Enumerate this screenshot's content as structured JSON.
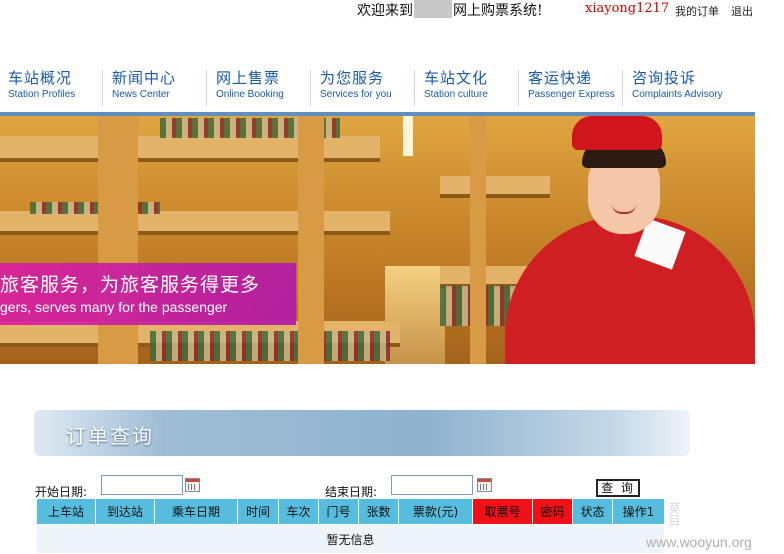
{
  "header": {
    "welcome_before": "欢迎来到",
    "welcome_after": "网上购票系统!",
    "username": "xiayong1217",
    "my_orders": "我的订单",
    "logout": "退出"
  },
  "nav": {
    "items": [
      {
        "zh": "车站概况",
        "en": "Station  Profiles"
      },
      {
        "zh": "新闻中心",
        "en": "News  Center"
      },
      {
        "zh": "网上售票",
        "en": "Online Booking"
      },
      {
        "zh": "为您服务",
        "en": "Services for you"
      },
      {
        "zh": "车站文化",
        "en": "Station culture"
      },
      {
        "zh": "客运快递",
        "en": "Passenger Express"
      },
      {
        "zh": "咨询投诉",
        "en": "Complaints Advisory"
      }
    ]
  },
  "banner": {
    "slogan_zh": "旅客服务，为旅客服务得更多",
    "slogan_en": "gers, serves many for the passenger"
  },
  "order_query": {
    "title": "订单查询",
    "start_date_label": "开始日期:",
    "start_date_value": "",
    "end_date_label": "结束日期:",
    "end_date_value": "",
    "query_button": "查 询"
  },
  "table": {
    "headers": [
      "上车站",
      "到达站",
      "乘车日期",
      "时间",
      "车次",
      "门号",
      "张数",
      "票款(元)",
      "取票号",
      "密码",
      "状态",
      "操作1"
    ],
    "empty_message": "暂无信息"
  },
  "watermark": {
    "site": "www.wooyun.org",
    "side": "莫目"
  },
  "colors": {
    "nav_text": "#1a5aa8",
    "table_header": "#56bddf",
    "table_header_highlight": "#f10f18",
    "username": "#cc0000"
  }
}
